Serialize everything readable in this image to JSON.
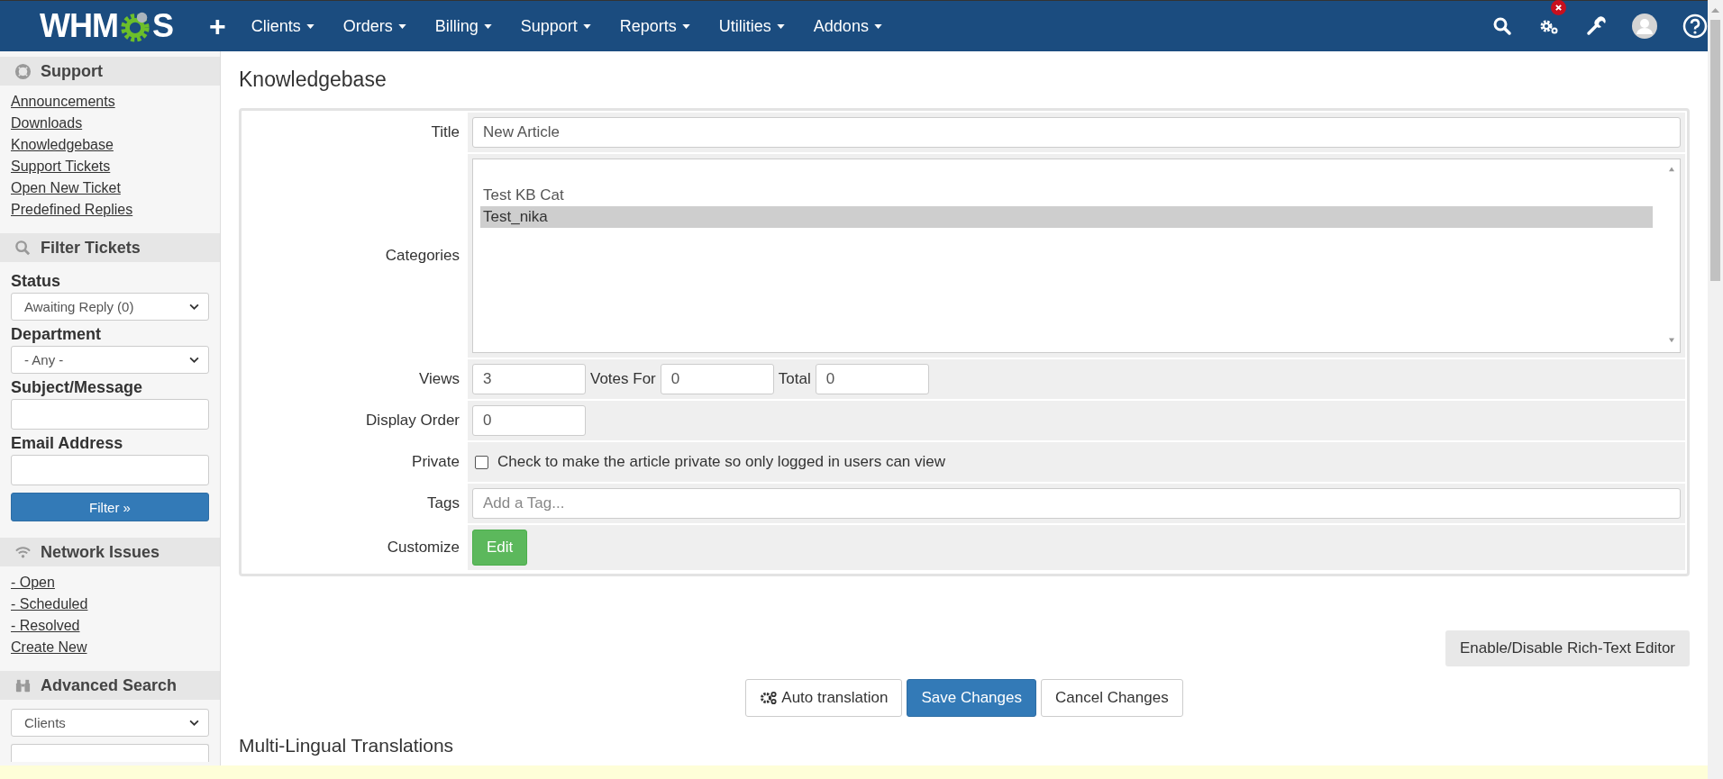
{
  "navbar": {
    "logo_start": "WHM",
    "logo_end": "S",
    "add": "+",
    "menus": [
      "Clients",
      "Orders",
      "Billing",
      "Support",
      "Reports",
      "Utilities",
      "Addons"
    ],
    "tools": [
      {
        "kind": "search"
      },
      {
        "kind": "gears",
        "alert": true
      },
      {
        "kind": "wrench"
      },
      {
        "kind": "avatar"
      },
      {
        "kind": "help"
      }
    ]
  },
  "sidebar": [
    {
      "kind": "links",
      "title": "Support",
      "links": [
        "Announcements",
        "Downloads",
        "Knowledgebase",
        "Support Tickets",
        "Open New Ticket",
        "Predefined Replies"
      ]
    },
    {
      "kind": "filter",
      "title": "Filter Tickets",
      "fields": [
        {
          "label": "Status",
          "kind": "select",
          "value": "Awaiting Reply (0)"
        },
        {
          "label": "Department",
          "kind": "select",
          "value": "- Any -"
        },
        {
          "label": "Subject/Message",
          "kind": "input"
        },
        {
          "label": "Email Address",
          "kind": "input"
        }
      ],
      "button": "Filter »"
    },
    {
      "kind": "links",
      "title": "Network Issues",
      "links": [
        "- Open",
        "- Scheduled",
        "- Resolved",
        "Create New"
      ]
    },
    {
      "kind": "search",
      "title": "Advanced Search",
      "selects": [
        "Clients"
      ]
    }
  ],
  "main": {
    "title": "Knowledgebase",
    "rows": [
      {
        "label": "Title",
        "kind": "text",
        "value": "New Article"
      },
      {
        "label": "Categories",
        "kind": "listbox",
        "options": [
          {
            "label": "Test KB Cat",
            "selected": false
          },
          {
            "label": "Test_nika",
            "selected": true
          }
        ]
      },
      {
        "label": "Views",
        "kind": "counts",
        "fields": [
          {
            "value": "3"
          },
          {
            "label": "Votes For",
            "value": "0"
          },
          {
            "label": "Total",
            "value": "0"
          }
        ]
      },
      {
        "label": "Display Order",
        "kind": "short",
        "value": "0"
      },
      {
        "label": "Private",
        "kind": "checkbox",
        "checked": false,
        "text": "Check to make the article private so only logged in users can view"
      },
      {
        "label": "Tags",
        "kind": "tags",
        "placeholder": "Add a Tag..."
      },
      {
        "label": "Customize",
        "kind": "button",
        "button": "Edit"
      }
    ],
    "editor_toggle": "Enable/Disable Rich-Text Editor",
    "actions": [
      {
        "label": "Auto translation",
        "kind": "default",
        "icon": true
      },
      {
        "label": "Save Changes",
        "kind": "primary",
        "icon": false
      },
      {
        "label": "Cancel Changes",
        "kind": "default",
        "icon": false
      }
    ],
    "section": "Multi-Lingual Translations"
  }
}
